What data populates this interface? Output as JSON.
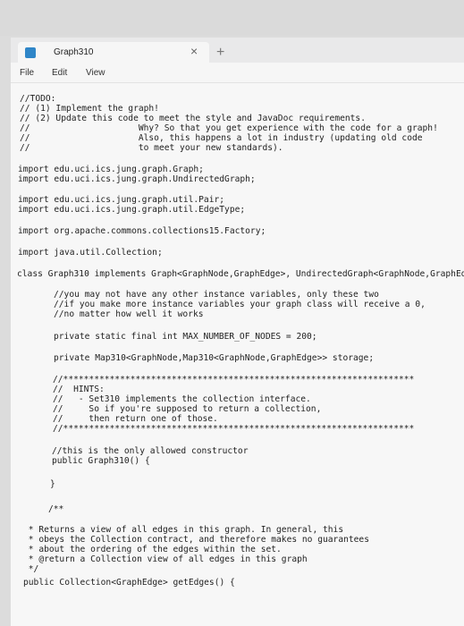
{
  "window": {
    "tab_title": "Graph310",
    "close_glyph": "×",
    "new_tab_glyph": "+"
  },
  "menu": {
    "items": [
      "File",
      "Edit",
      "View"
    ]
  },
  "code": {
    "lines": [
      "//TODO:",
      "// (1) Implement the graph!",
      "// (2) Update this code to meet the style and JavaDoc requirements.",
      "//                     Why? So that you get experience with the code for a graph!",
      "//                     Also, this happens a lot in industry (updating old code",
      "//                     to meet your new standards).",
      "import edu.uci.ics.jung.graph.Graph;",
      "import edu.uci.ics.jung.graph.UndirectedGraph;",
      "import edu.uci.ics.jung.graph.util.Pair;",
      "import edu.uci.ics.jung.graph.util.EdgeType;",
      "import org.apache.commons.collections15.Factory;",
      "import java.util.Collection;",
      "class Graph310 implements Graph<GraphNode,GraphEdge>, UndirectedGraph<GraphNode,GraphEd",
      "//you may not have any other instance variables, only these two",
      "//if you make more instance variables your graph class will receive a 0,",
      "//no matter how well it works",
      "private static final int MAX_NUMBER_OF_NODES = 200;",
      "private Map310<GraphNode,Map310<GraphNode,GraphEdge>> storage;",
      "//********************************************************************",
      "//  HINTS:",
      "//   - Set310 implements the collection interface.",
      "//     So if you're supposed to return a collection,",
      "//     then return one of those.",
      "//********************************************************************",
      "//this is the only allowed constructor",
      "public Graph310() {",
      "}",
      "/**",
      " * Returns a view of all edges in this graph. In general, this",
      " * obeys the Collection contract, and therefore makes no guarantees",
      " * about the ordering of the edges within the set.",
      " * @return a Collection view of all edges in this graph",
      " */",
      "public Collection<GraphEdge> getEdges() {"
    ]
  }
}
